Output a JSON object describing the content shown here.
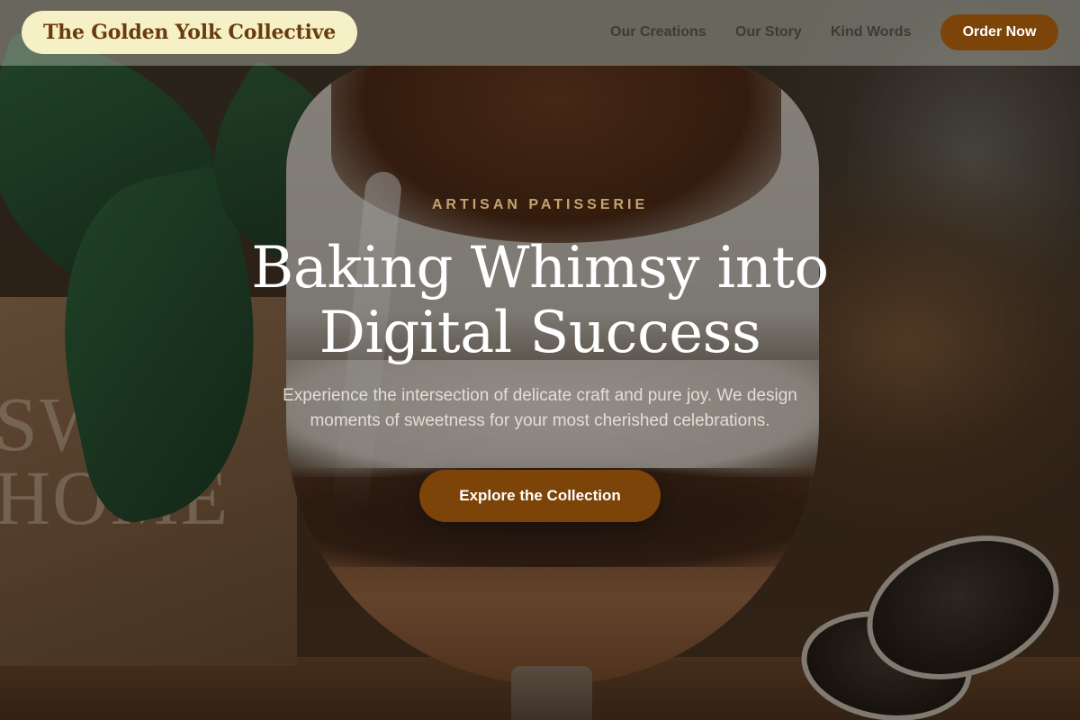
{
  "header": {
    "brand": "The Golden Yolk Collective",
    "nav": [
      {
        "label": "Our Creations"
      },
      {
        "label": "Our Story"
      },
      {
        "label": "Kind Words"
      }
    ],
    "cta_label": "Order Now"
  },
  "hero": {
    "eyebrow": "ARTISAN PATISSERIE",
    "headline_line1": "Baking Whimsy into",
    "headline_line2": "Digital Success",
    "subtitle_line1": "Experience the intersection of delicate craft and pure joy. We design",
    "subtitle_line2": "moments of sweetness for your most cherished celebrations.",
    "button_label": "Explore the Collection"
  },
  "colors": {
    "brand_bg": "#f5f0c6",
    "brand_text": "#6b3b10",
    "accent": "#7d4409",
    "eyebrow": "#c6a36e"
  }
}
